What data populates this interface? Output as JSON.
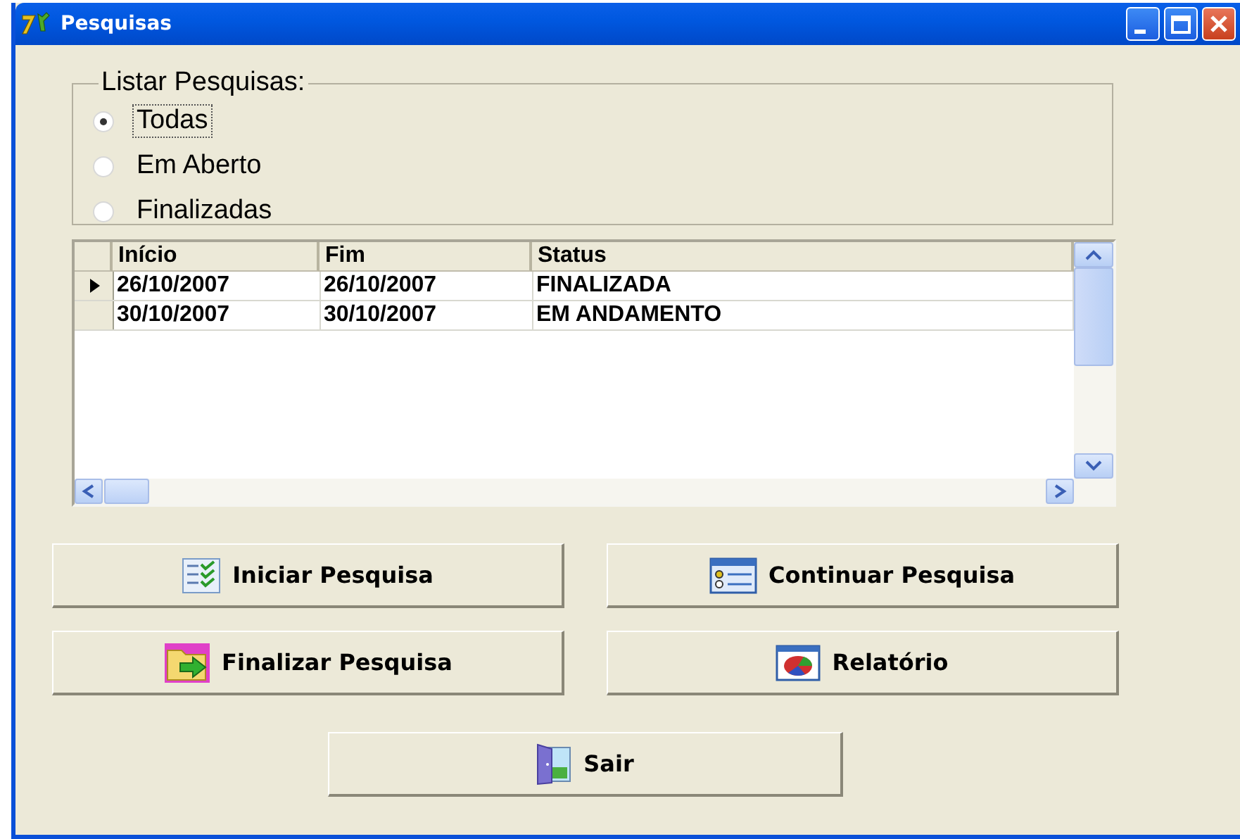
{
  "window": {
    "title": "Pesquisas"
  },
  "filter": {
    "legend": "Listar Pesquisas:",
    "options": [
      {
        "label": "Todas",
        "selected": true
      },
      {
        "label": "Em Aberto",
        "selected": false
      },
      {
        "label": "Finalizadas",
        "selected": false
      }
    ]
  },
  "table": {
    "columns": [
      "Início",
      "Fim",
      "Status"
    ],
    "rows": [
      {
        "cells": [
          "26/10/2007",
          "26/10/2007",
          "FINALIZADA"
        ],
        "selected": true
      },
      {
        "cells": [
          "30/10/2007",
          "30/10/2007",
          "EM ANDAMENTO"
        ],
        "selected": false
      }
    ]
  },
  "buttons": [
    {
      "label": "Iniciar Pesquisa",
      "kind": "checklist"
    },
    {
      "label": "Continuar Pesquisa",
      "kind": "form"
    },
    {
      "label": "Finalizar Pesquisa",
      "kind": "folder"
    },
    {
      "label": "Relatório",
      "kind": "chart"
    },
    {
      "label": "Sair",
      "kind": "door"
    }
  ]
}
